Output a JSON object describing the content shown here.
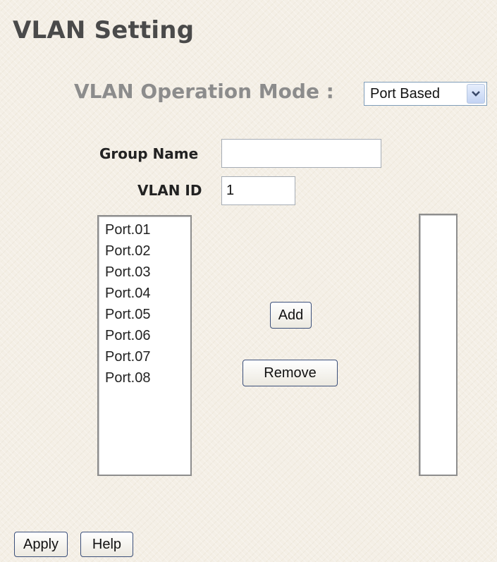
{
  "page": {
    "title": "VLAN Setting"
  },
  "operation_mode": {
    "label": "VLAN Operation Mode :",
    "selected": "Port Based",
    "arrow_icon": "chevron-down-icon"
  },
  "form": {
    "group_name_label": "Group Name",
    "group_name_value": "",
    "vlan_id_label": "VLAN ID",
    "vlan_id_value": "1"
  },
  "ports_list": {
    "items": [
      "Port.01",
      "Port.02",
      "Port.03",
      "Port.04",
      "Port.05",
      "Port.06",
      "Port.07",
      "Port.08"
    ]
  },
  "member_list": {
    "items": []
  },
  "actions": {
    "add_label": "Add",
    "remove_label": "Remove",
    "apply_label": "Apply",
    "help_label": "Help"
  }
}
